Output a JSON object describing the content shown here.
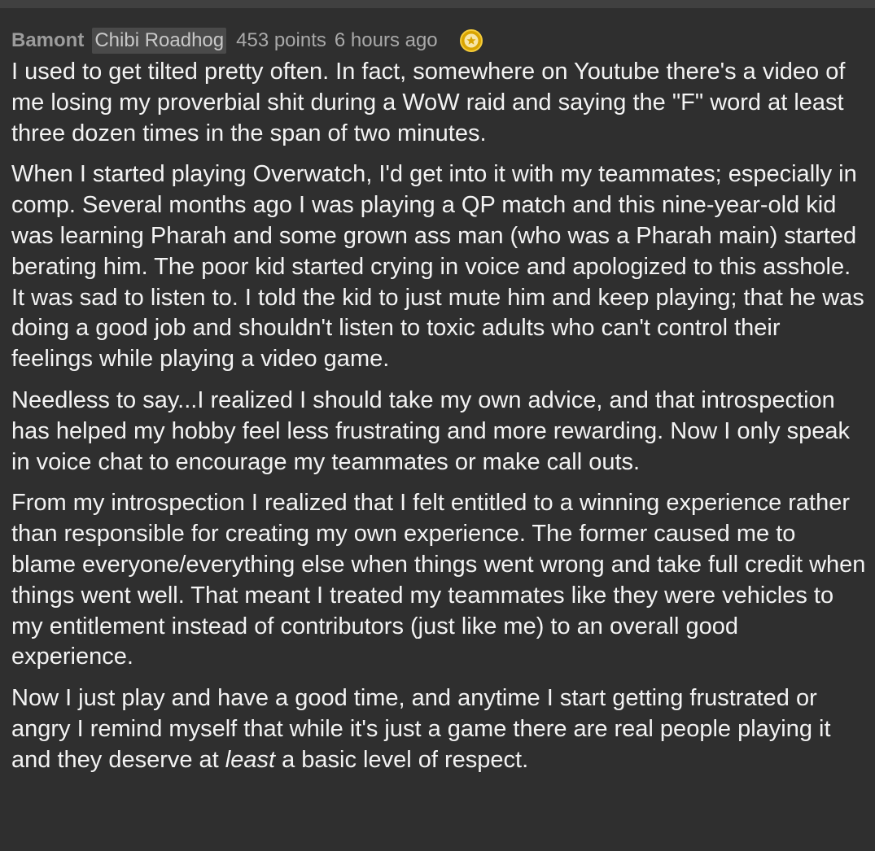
{
  "comment": {
    "author": "Bamont",
    "flair": "Chibi Roadhog",
    "points": "453 points",
    "time": "6 hours ago",
    "award_icon": "gold-award-icon",
    "paragraphs": [
      "I used to get tilted pretty often. In fact, somewhere on Youtube there's a video of me losing my proverbial shit during a WoW raid and saying the \"F\" word at least three dozen times in the span of two minutes.",
      "When I started playing Overwatch, I'd get into it with my teammates; especially in comp. Several months ago I was playing a QP match and this nine-year-old kid was learning Pharah and some grown ass man (who was a Pharah main) started berating him. The poor kid started crying in voice and apologized to this asshole. It was sad to listen to. I told the kid to just mute him and keep playing; that he was doing a good job and shouldn't listen to toxic adults who can't control their feelings while playing a video game.",
      "Needless to say...I realized I should take my own advice, and that introspection has helped my hobby feel less frustrating and more rewarding. Now I only speak in voice chat to encourage my teammates or make call outs.",
      "From my introspection I realized that I felt entitled to a winning experience rather than responsible for creating my own experience. The former caused me to blame everyone/everything else when things went wrong and take full credit when things went well. That meant I treated my teammates like they were vehicles to my entitlement instead of contributors (just like me) to an overall good experience."
    ],
    "last_paragraph": {
      "before": "Now I just play and have a good time, and anytime I start getting frustrated or angry I remind myself that while it's just a game there are real people playing it and they deserve at ",
      "emphasis": "least",
      "after": " a basic level of respect."
    }
  },
  "colors": {
    "background": "#2f2f2f",
    "text": "#f3f3f3",
    "meta": "#a9a9a9",
    "flair_bg": "#4a4a4a",
    "award": "#e6b800"
  }
}
